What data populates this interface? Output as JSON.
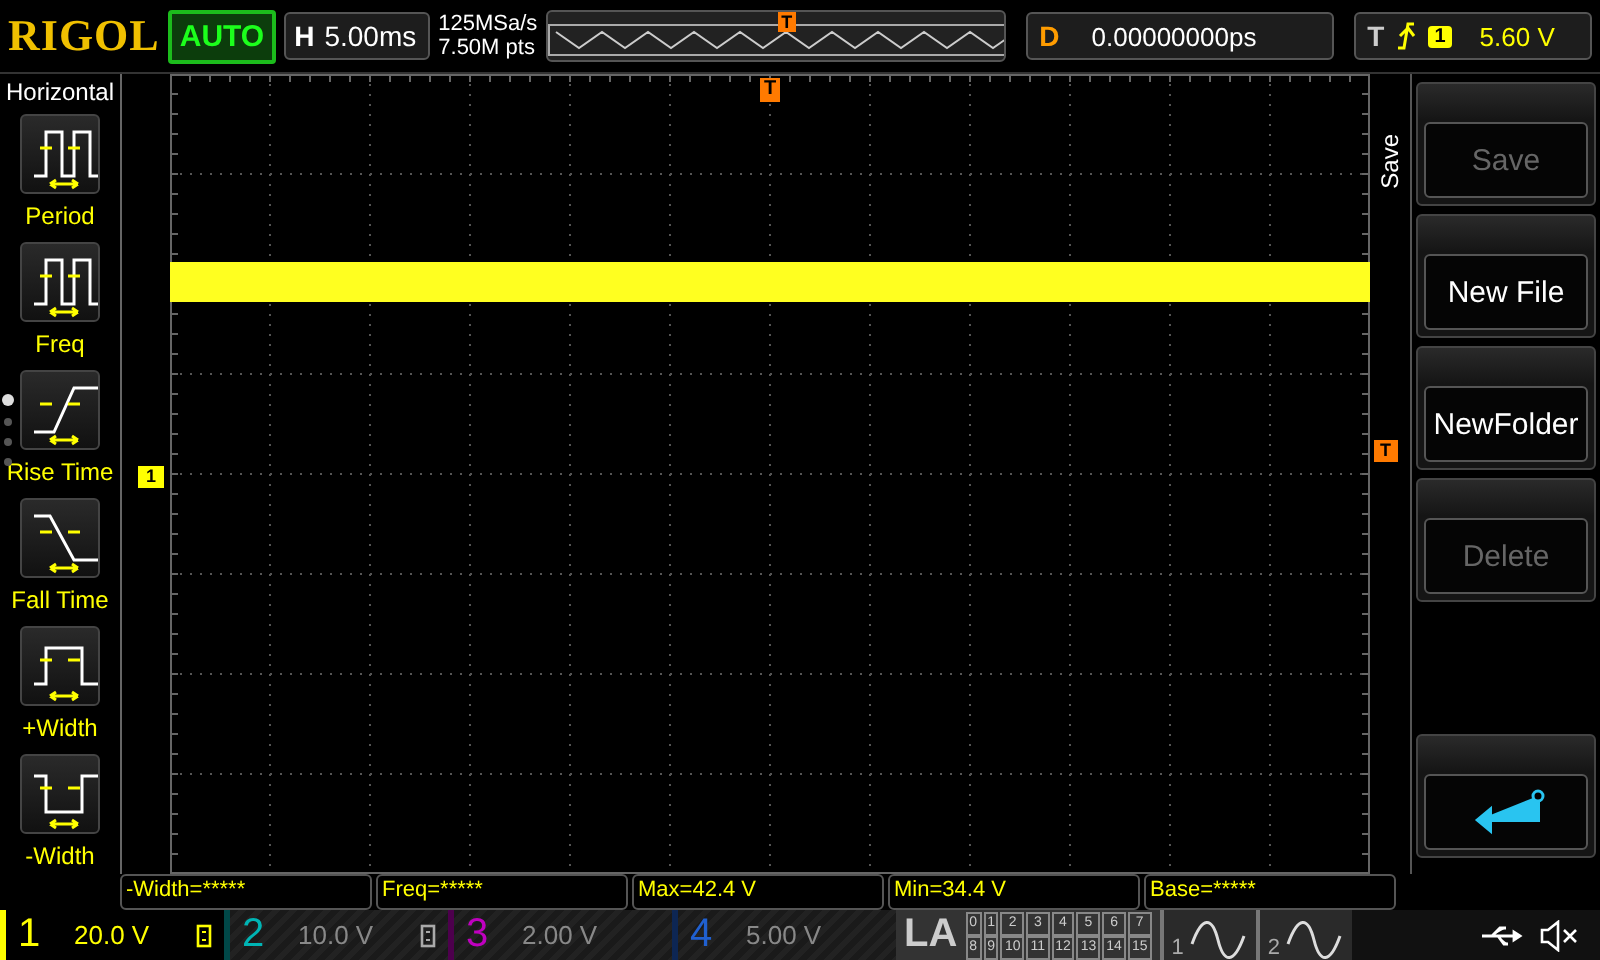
{
  "brand": "RIGOL",
  "run_status": "AUTO",
  "timebase": {
    "label": "H",
    "value": "5.00ms"
  },
  "acquisition": {
    "sample_rate": "125MSa/s",
    "memory_depth": "7.50M pts"
  },
  "memory_trigger_marker": "T",
  "delay": {
    "label": "D",
    "value": "0.00000000ps"
  },
  "trigger": {
    "label": "T",
    "source": "1",
    "level": "5.60 V"
  },
  "left_menu": {
    "title": "Horizontal",
    "items": [
      {
        "label": "Period",
        "kind": "period"
      },
      {
        "label": "Freq",
        "kind": "freq"
      },
      {
        "label": "Rise Time",
        "kind": "rise"
      },
      {
        "label": "Fall Time",
        "kind": "fall"
      },
      {
        "label": "+Width",
        "kind": "pwidth"
      },
      {
        "label": "-Width",
        "kind": "nwidth"
      }
    ],
    "pages": [
      {
        "selected": true
      },
      {
        "selected": false
      },
      {
        "selected": false
      },
      {
        "selected": false
      }
    ]
  },
  "grid": {
    "channel_marker": "1",
    "trigger_position_marker": "T",
    "trigger_level_marker": "T"
  },
  "right_menu": {
    "title": "Save",
    "buttons": [
      {
        "label": "Save",
        "disabled": true
      },
      {
        "label": "New File",
        "disabled": false
      },
      {
        "label": "NewFolder",
        "disabled": false
      },
      {
        "label": "Delete",
        "disabled": true
      }
    ]
  },
  "measurements": [
    "-Width=*****",
    "Freq=*****",
    "Max=42.4 V",
    "Min=34.4 V",
    "Base=*****"
  ],
  "channels": [
    {
      "number": "1",
      "scale": "20.0 V",
      "on": true,
      "bw_limit": true,
      "color": "#ffff00"
    },
    {
      "number": "2",
      "scale": "10.0 V",
      "on": false,
      "bw_limit": true,
      "color": "#00b4b4"
    },
    {
      "number": "3",
      "scale": "2.00 V",
      "on": false,
      "bw_limit": false,
      "color": "#c000c0"
    },
    {
      "number": "4",
      "scale": "5.00 V",
      "on": false,
      "bw_limit": false,
      "color": "#2060d0"
    }
  ],
  "la": {
    "label": "LA",
    "digital_channels": [
      "0",
      "1",
      "2",
      "3",
      "4",
      "5",
      "6",
      "7",
      "8",
      "9",
      "10",
      "11",
      "12",
      "13",
      "14",
      "15"
    ]
  },
  "generators": [
    {
      "number": "1"
    },
    {
      "number": "2"
    }
  ]
}
